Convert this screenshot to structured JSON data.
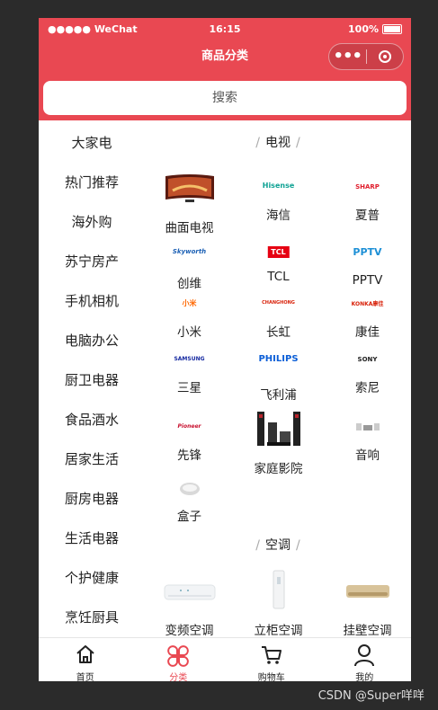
{
  "status_bar": {
    "signal": "●●●●● WeChat",
    "time": "16:15",
    "battery": "100%"
  },
  "navbar": {
    "title": "商品分类"
  },
  "search": {
    "placeholder": "搜索"
  },
  "sidebar": {
    "items": [
      {
        "label": "大家电"
      },
      {
        "label": "热门推荐"
      },
      {
        "label": "海外购"
      },
      {
        "label": "苏宁房产"
      },
      {
        "label": "手机相机"
      },
      {
        "label": "电脑办公"
      },
      {
        "label": "厨卫电器"
      },
      {
        "label": "食品酒水"
      },
      {
        "label": "居家生活"
      },
      {
        "label": "厨房电器"
      },
      {
        "label": "生活电器"
      },
      {
        "label": "个护健康"
      },
      {
        "label": "烹饪厨具"
      }
    ]
  },
  "sections": [
    {
      "title": "电视",
      "items": [
        {
          "label": "曲面电视"
        },
        {
          "label": "海信",
          "logo": "Hisense"
        },
        {
          "label": "夏普",
          "logo": "SHARP"
        },
        {
          "label": "创维",
          "logo": "Skyworth"
        },
        {
          "label": "TCL",
          "logo": "TCL"
        },
        {
          "label": "PPTV",
          "logo": "PPTV"
        },
        {
          "label": "小米",
          "logo": "小米"
        },
        {
          "label": "长虹",
          "logo": "CHANGHONG"
        },
        {
          "label": "康佳",
          "logo": "KONKA康佳"
        },
        {
          "label": "三星",
          "logo": "SAMSUNG"
        },
        {
          "label": "飞利浦",
          "logo": "PHILIPS"
        },
        {
          "label": "索尼",
          "logo": "SONY"
        },
        {
          "label": "先锋",
          "logo": "Pioneer"
        },
        {
          "label": "家庭影院"
        },
        {
          "label": "音响"
        },
        {
          "label": "盒子"
        }
      ]
    },
    {
      "title": "空调",
      "items": [
        {
          "label": "变频空调"
        },
        {
          "label": "立柜空调"
        },
        {
          "label": "挂壁空调"
        }
      ]
    }
  ],
  "tabbar": {
    "items": [
      {
        "label": "首页",
        "icon": "home-icon"
      },
      {
        "label": "分类",
        "icon": "category-icon"
      },
      {
        "label": "购物车",
        "icon": "cart-icon"
      },
      {
        "label": "我的",
        "icon": "user-icon"
      }
    ],
    "active_index": 1
  },
  "colors": {
    "brand": "#e94852",
    "active": "#e94852"
  },
  "watermark": "CSDN @Super咩咩"
}
